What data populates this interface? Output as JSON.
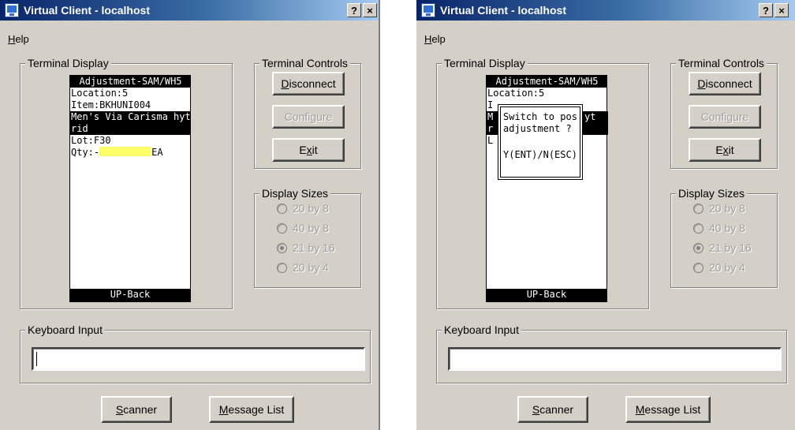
{
  "windows": [
    {
      "title": "Virtual Client - localhost",
      "title_buttons": {
        "help": "?",
        "close": "×"
      },
      "menu": {
        "help": "Help"
      },
      "terminal_display": {
        "legend": "Terminal Display",
        "lines": [
          "Adjustment-SAM/WH5",
          "Location:5",
          "Item:BKHUNI004",
          "Men's Via Carisma hyt",
          "rid",
          "Lot:F30"
        ],
        "qty_prefix": "Qty:-",
        "qty_unit": "EA",
        "footer": "UP-Back"
      },
      "terminal_controls": {
        "legend": "Terminal Controls",
        "disconnect": "Disconnect",
        "configure": "Configure",
        "exit": "Exit"
      },
      "display_sizes": {
        "legend": "Display Sizes",
        "options": [
          "20 by 8",
          "40 by 8",
          "21 by 16",
          "20 by 4"
        ],
        "selected": "21 by 16"
      },
      "keyboard_input": {
        "legend": "Keyboard Input",
        "value": ""
      },
      "bottom_buttons": {
        "scanner": "Scanner",
        "message_list": "Message List"
      }
    },
    {
      "title": "Virtual Client - localhost",
      "title_buttons": {
        "help": "?",
        "close": "×"
      },
      "menu": {
        "help": "Help"
      },
      "terminal_display": {
        "legend": "Terminal Display",
        "lines": [
          "Adjustment-SAM/WH5",
          "Location:5",
          "I",
          "M",
          "r",
          "L"
        ],
        "behind_right": [
          "yt",
          ""
        ],
        "footer": "UP-Back",
        "dialog": {
          "line1": "Switch to positi",
          "line2": "adjustment ?",
          "options": "Y(ENT)/N(ESC)"
        }
      },
      "terminal_controls": {
        "legend": "Terminal Controls",
        "disconnect": "Disconnect",
        "configure": "Configure",
        "exit": "Exit"
      },
      "display_sizes": {
        "legend": "Display Sizes",
        "options": [
          "20 by 8",
          "40 by 8",
          "21 by 16",
          "20 by 4"
        ],
        "selected": "21 by 16"
      },
      "keyboard_input": {
        "legend": "Keyboard Input",
        "value": ""
      },
      "bottom_buttons": {
        "scanner": "Scanner",
        "message_list": "Message List"
      }
    }
  ]
}
